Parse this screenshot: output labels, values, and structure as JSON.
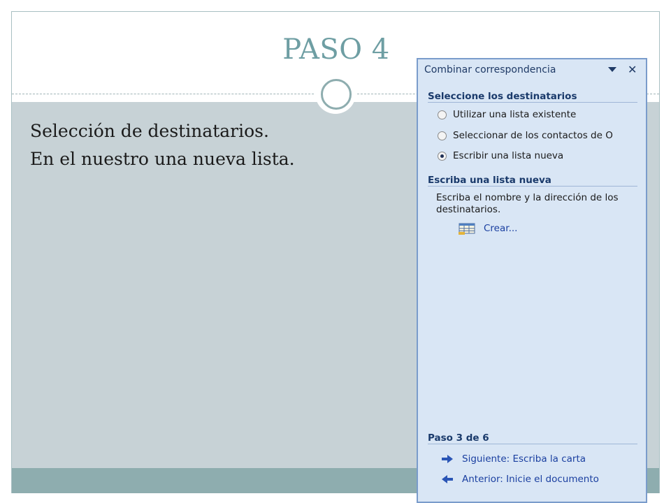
{
  "slide": {
    "title": "PASO 4",
    "body_lines": [
      "Selección de destinatarios.",
      "En el nuestro una nueva lista."
    ]
  },
  "task_pane": {
    "title": "Combinar correspondencia",
    "section1_heading": "Seleccione los destinatarios",
    "options": [
      {
        "label": "Utilizar una lista existente",
        "selected": false
      },
      {
        "label": "Seleccionar de los contactos de O",
        "selected": false
      },
      {
        "label": "Escribir una lista nueva",
        "selected": true
      }
    ],
    "section2_heading": "Escriba una lista nueva",
    "section2_desc": "Escriba el nombre y la dirección de los destinatarios.",
    "create_label": "Crear...",
    "step_heading": "Paso 3 de 6",
    "next_label": "Siguiente: Escriba la carta",
    "prev_label": "Anterior: Inicie el documento",
    "icons": {
      "dropdown": "dropdown-arrow-icon",
      "close": "close-icon",
      "create": "address-list-icon",
      "next": "arrow-right-icon",
      "prev": "arrow-left-icon"
    },
    "colors": {
      "link": "#1a3fa0",
      "pane_bg": "#d9e6f5",
      "heading": "#1a3a6b"
    }
  }
}
